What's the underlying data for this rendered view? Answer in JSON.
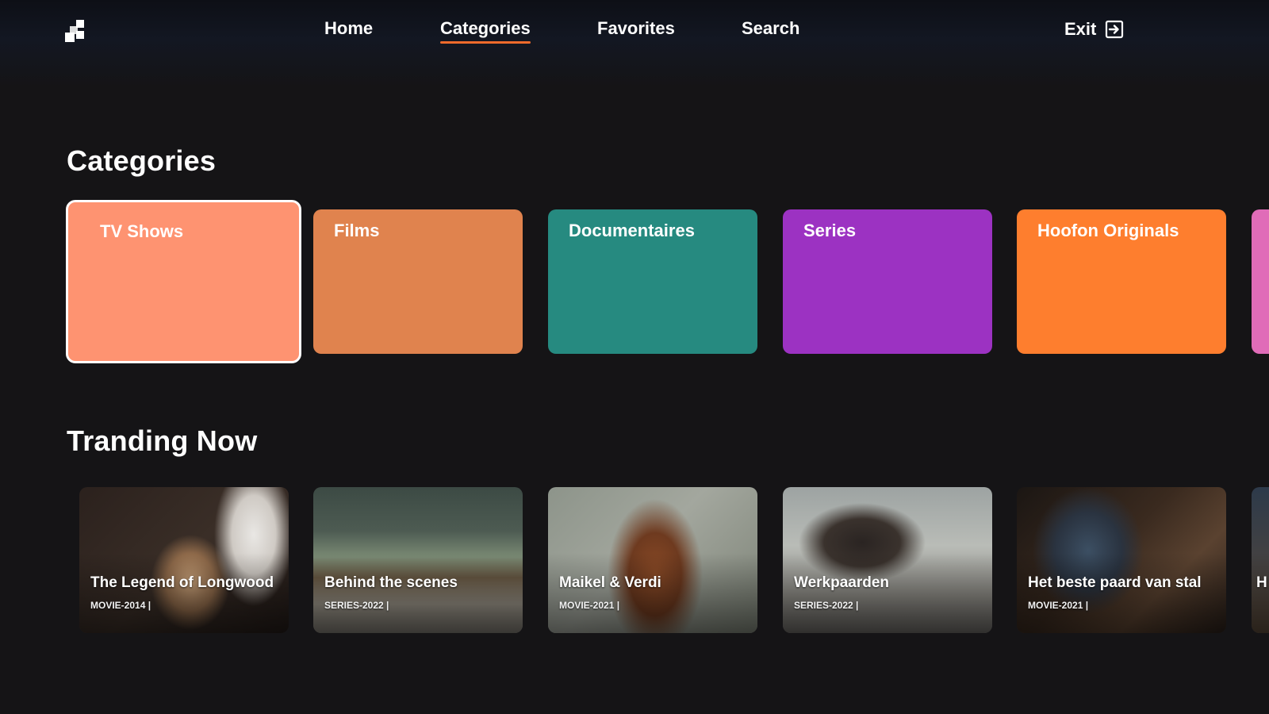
{
  "nav": {
    "items": [
      {
        "label": "Home",
        "active": false
      },
      {
        "label": "Categories",
        "active": true
      },
      {
        "label": "Favorites",
        "active": false
      },
      {
        "label": "Search",
        "active": false
      }
    ],
    "exit_label": "Exit",
    "logo_icon": "app-logo-icon",
    "exit_icon": "exit-arrow-icon",
    "accent_color": "#f06a2b"
  },
  "categories": {
    "title": "Categories",
    "items": [
      {
        "label": "TV Shows",
        "color": "#fe9371",
        "focused": true
      },
      {
        "label": "Films",
        "color": "#e0834e"
      },
      {
        "label": "Documentaires",
        "color": "#268a80"
      },
      {
        "label": "Series",
        "color": "#9c32c2"
      },
      {
        "label": "Hoofon Originals",
        "color": "#fe7e2e"
      },
      {
        "label": "",
        "color": "#e06cb8"
      }
    ]
  },
  "trending": {
    "title": "Tranding Now",
    "items": [
      {
        "title": "The Legend of Longwood",
        "meta": "MOVIE-2014 |"
      },
      {
        "title": "Behind the scenes",
        "meta": "SERIES-2022 |"
      },
      {
        "title": "Maikel & Verdi",
        "meta": "MOVIE-2021 |"
      },
      {
        "title": "Werkpaarden",
        "meta": "SERIES-2022 |"
      },
      {
        "title": "Het beste paard van stal",
        "meta": "MOVIE-2021 |"
      },
      {
        "title": "H",
        "meta": ""
      }
    ]
  }
}
